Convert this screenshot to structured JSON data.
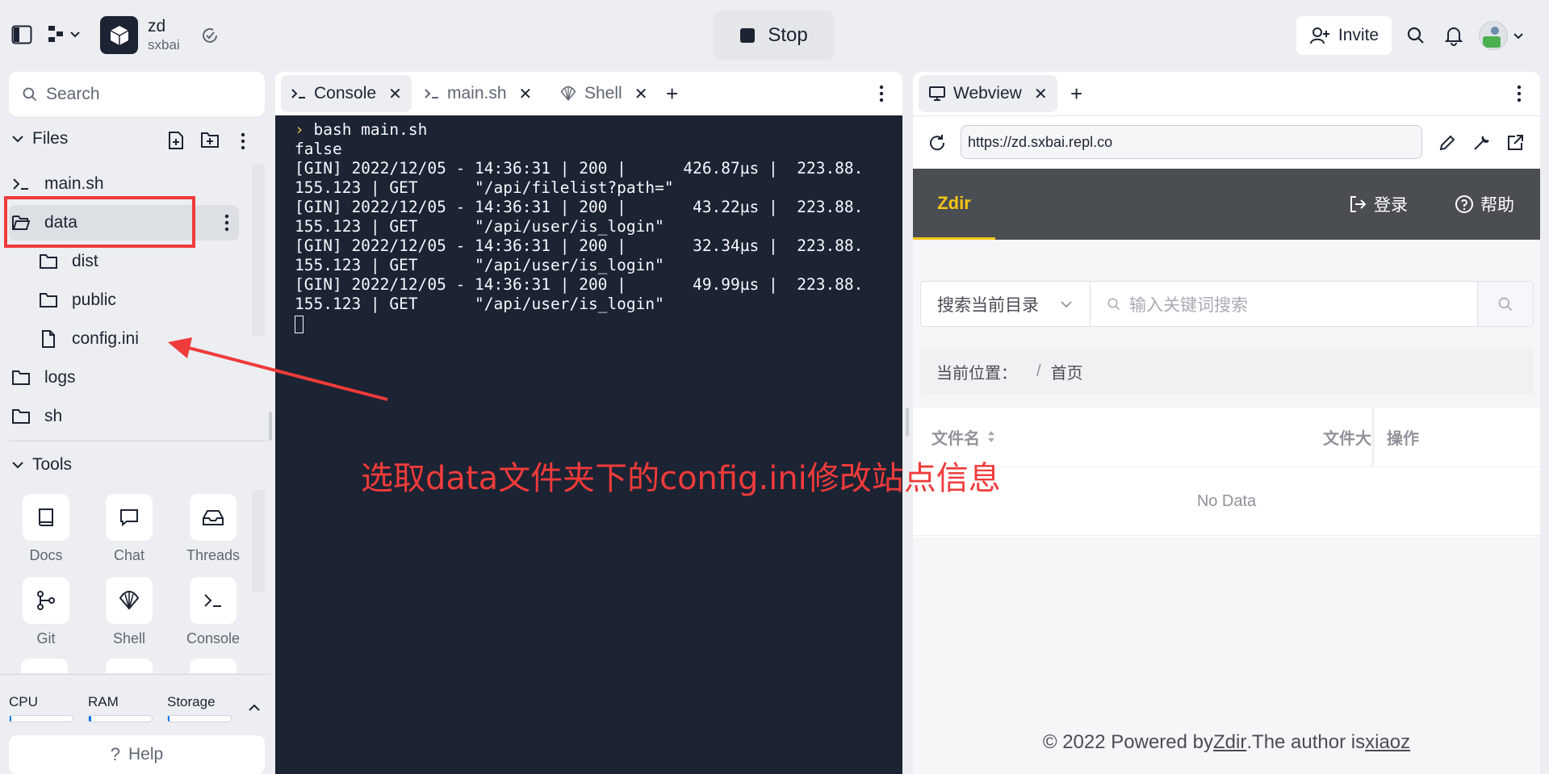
{
  "repl": {
    "name": "zd",
    "owner": "sxbai"
  },
  "topbar": {
    "stop_label": "Stop",
    "invite_label": "Invite"
  },
  "sidebar": {
    "search_placeholder": "Search",
    "files_title": "Files",
    "files": [
      {
        "name": "main.sh",
        "type": "shell"
      },
      {
        "name": "data",
        "type": "folder-open"
      },
      {
        "name": "dist",
        "type": "folder"
      },
      {
        "name": "public",
        "type": "folder"
      },
      {
        "name": "config.ini",
        "type": "file"
      },
      {
        "name": "logs",
        "type": "folder"
      },
      {
        "name": "sh",
        "type": "folder"
      }
    ],
    "tools_title": "Tools",
    "tools": [
      {
        "label": "Docs",
        "icon": "book-icon"
      },
      {
        "label": "Chat",
        "icon": "chat-icon"
      },
      {
        "label": "Threads",
        "icon": "inbox-icon"
      },
      {
        "label": "Git",
        "icon": "git-icon"
      },
      {
        "label": "Shell",
        "icon": "shell-icon"
      },
      {
        "label": "Console",
        "icon": "console-icon"
      }
    ],
    "meters": [
      {
        "label": "CPU",
        "fill": 0.02
      },
      {
        "label": "RAM",
        "fill": 0.04
      },
      {
        "label": "Storage",
        "fill": 0.02
      }
    ],
    "help_label": "Help"
  },
  "console_pane": {
    "tabs": [
      {
        "label": "Console",
        "icon": "console-icon",
        "active": true
      },
      {
        "label": "main.sh",
        "icon": "console-icon",
        "active": false
      },
      {
        "label": "Shell",
        "icon": "shell-icon",
        "active": false
      }
    ],
    "command": "bash main.sh",
    "output": [
      "false",
      "[GIN] 2022/12/05 - 14:36:31 | 200 |      426.87µs |  223.88.",
      "155.123 | GET      \"/api/filelist?path=\"",
      "[GIN] 2022/12/05 - 14:36:31 | 200 |       43.22µs |  223.88.",
      "155.123 | GET      \"/api/user/is_login\"",
      "[GIN] 2022/12/05 - 14:36:31 | 200 |       32.34µs |  223.88.",
      "155.123 | GET      \"/api/user/is_login\"",
      "[GIN] 2022/12/05 - 14:36:31 | 200 |       49.99µs |  223.88.",
      "155.123 | GET      \"/api/user/is_login\""
    ]
  },
  "webview_pane": {
    "tab_label": "Webview",
    "url": "https://zd.sxbai.repl.co"
  },
  "zdir": {
    "brand": "Zdir",
    "login_label": "登录",
    "help_label": "帮助",
    "select_label": "搜索当前目录",
    "search_placeholder": "输入关键词搜索",
    "crumb_label": "当前位置：",
    "crumb_sep": "/",
    "crumb_home": "首页",
    "col_name": "文件名",
    "col_size": "文件大",
    "col_action": "操作",
    "empty_text": "No Data",
    "footer_prefix": "© 2022 Powered by ",
    "footer_link1": "Zdir",
    "footer_mid": ".The author is ",
    "footer_link2": "xiaoz"
  },
  "annotation": {
    "text": "选取data文件夹下的config.ini修改站点信息",
    "color": "#ef3b3b"
  }
}
